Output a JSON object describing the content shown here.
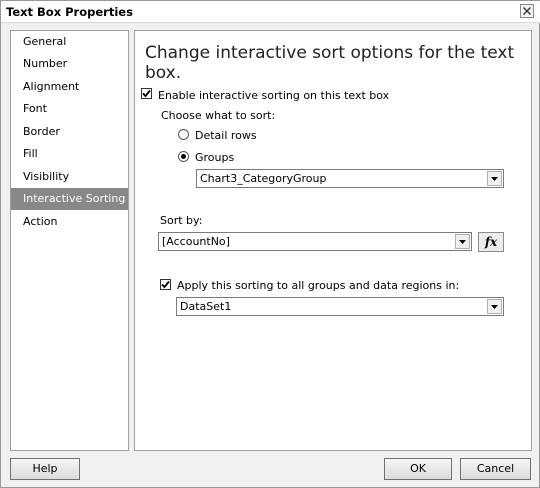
{
  "window": {
    "title": "Text Box Properties"
  },
  "sidebar": {
    "items": [
      {
        "label": "General"
      },
      {
        "label": "Number"
      },
      {
        "label": "Alignment"
      },
      {
        "label": "Font"
      },
      {
        "label": "Border"
      },
      {
        "label": "Fill"
      },
      {
        "label": "Visibility"
      },
      {
        "label": "Interactive Sorting",
        "selected": true
      },
      {
        "label": "Action"
      }
    ]
  },
  "main": {
    "heading": "Change interactive sort options for the text box.",
    "enable_sorting": {
      "label": "Enable interactive sorting on this text box",
      "checked": true
    },
    "choose_label": "Choose what to sort:",
    "detail_rows": {
      "label": "Detail rows",
      "selected": false
    },
    "groups": {
      "label": "Groups",
      "selected": true
    },
    "groups_combo": {
      "value": "Chart3_CategoryGroup"
    },
    "sort_by_label": "Sort by:",
    "sort_by_combo": {
      "value": "[AccountNo]"
    },
    "fx_label": "fx",
    "apply_sorting": {
      "label": "Apply this sorting to all groups and data regions in:",
      "checked": true
    },
    "dataset_combo": {
      "value": "DataSet1"
    }
  },
  "footer": {
    "help_label": "Help",
    "ok_label": "OK",
    "cancel_label": "Cancel"
  }
}
